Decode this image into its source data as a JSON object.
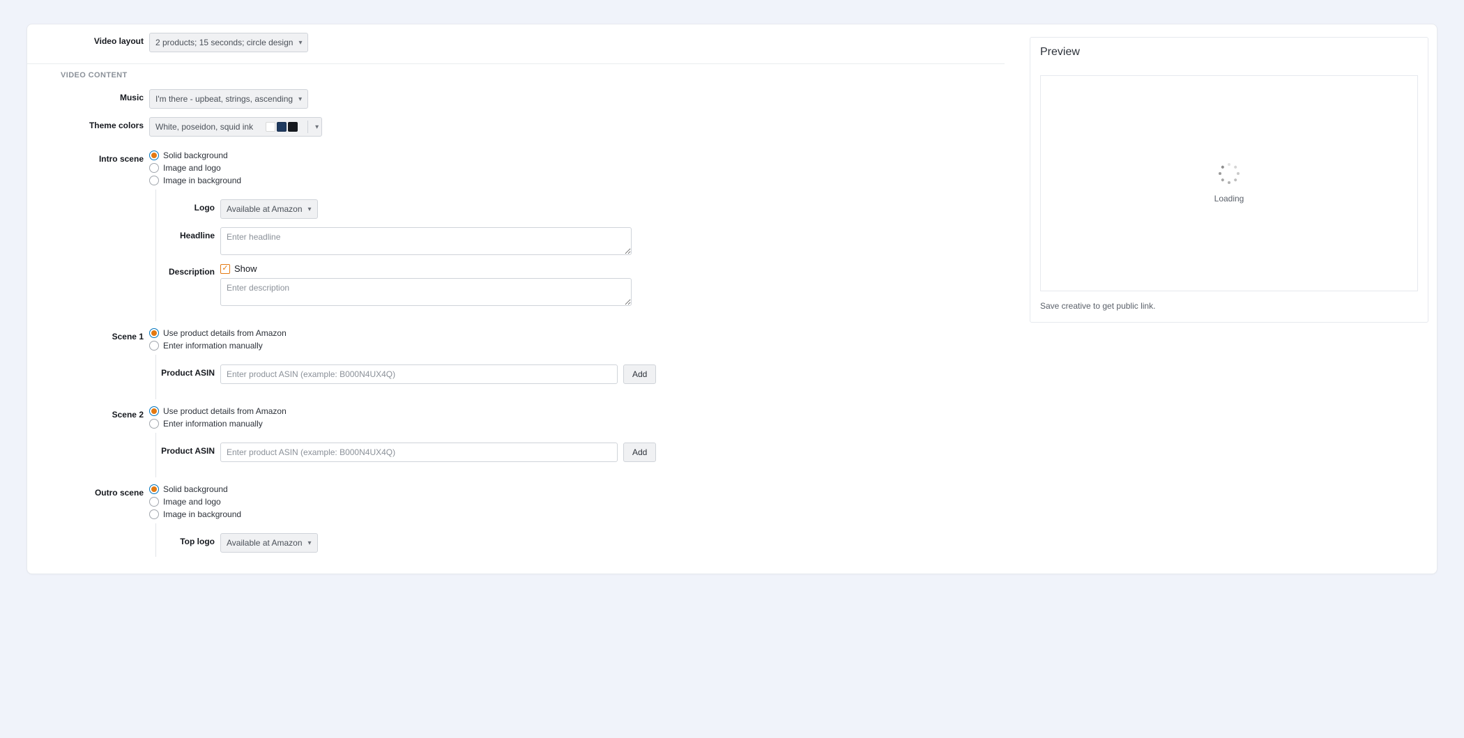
{
  "labels": {
    "video_layout": "Video layout",
    "video_content": "VIDEO CONTENT",
    "music": "Music",
    "theme_colors": "Theme colors",
    "intro_scene": "Intro scene",
    "scene1": "Scene 1",
    "scene2": "Scene 2",
    "outro_scene": "Outro scene",
    "logo": "Logo",
    "top_logo": "Top logo",
    "headline": "Headline",
    "description": "Description",
    "product_asin": "Product ASIN"
  },
  "dropdowns": {
    "video_layout": "2 products; 15 seconds; circle design",
    "music": "I'm there - upbeat, strings, ascending",
    "theme_colors": "White, poseidon, squid ink",
    "logo": "Available at Amazon",
    "top_logo": "Available at Amazon"
  },
  "theme_swatches": [
    "#ffffff",
    "#1f3a5f",
    "#16191f"
  ],
  "intro_options": {
    "opt1": "Solid background",
    "opt2": "Image and logo",
    "opt3": "Image in background"
  },
  "scene_options": {
    "opt1": "Use product details from Amazon",
    "opt2": "Enter information manually"
  },
  "outro_options": {
    "opt1": "Solid background",
    "opt2": "Image and logo",
    "opt3": "Image in background"
  },
  "placeholders": {
    "headline": "Enter headline",
    "description": "Enter description",
    "asin": "Enter product ASIN (example: B000N4UX4Q)"
  },
  "checkbox": {
    "show": "Show"
  },
  "buttons": {
    "add": "Add"
  },
  "preview": {
    "title": "Preview",
    "loading": "Loading",
    "hint": "Save creative to get public link."
  }
}
